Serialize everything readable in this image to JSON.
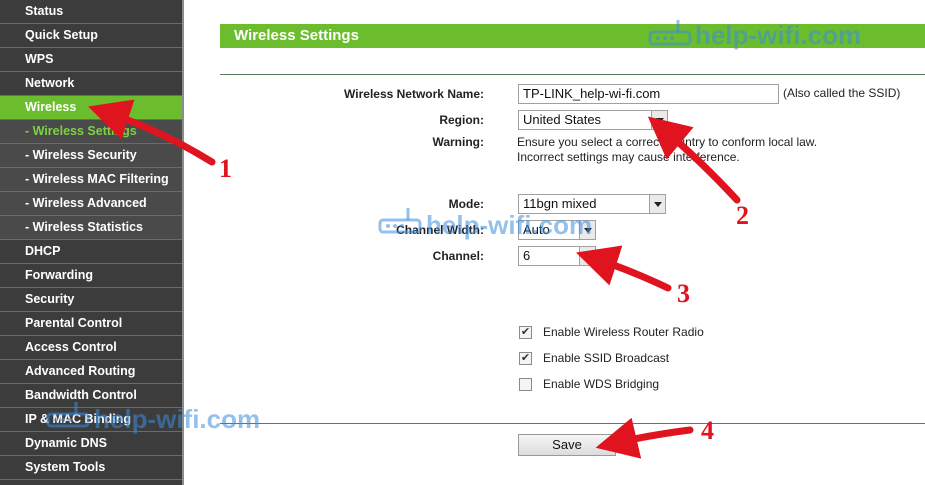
{
  "sidebar": {
    "items": [
      {
        "label": "Status",
        "type": "main"
      },
      {
        "label": "Quick Setup",
        "type": "main"
      },
      {
        "label": "WPS",
        "type": "main"
      },
      {
        "label": "Network",
        "type": "main"
      },
      {
        "label": "Wireless",
        "type": "active"
      },
      {
        "label": "- Wireless Settings",
        "type": "sub-current"
      },
      {
        "label": "- Wireless Security",
        "type": "sub"
      },
      {
        "label": "- Wireless MAC Filtering",
        "type": "sub"
      },
      {
        "label": "- Wireless Advanced",
        "type": "sub"
      },
      {
        "label": "- Wireless Statistics",
        "type": "sub"
      },
      {
        "label": "DHCP",
        "type": "main"
      },
      {
        "label": "Forwarding",
        "type": "main"
      },
      {
        "label": "Security",
        "type": "main"
      },
      {
        "label": "Parental Control",
        "type": "main"
      },
      {
        "label": "Access Control",
        "type": "main"
      },
      {
        "label": "Advanced Routing",
        "type": "main"
      },
      {
        "label": "Bandwidth Control",
        "type": "main"
      },
      {
        "label": "IP & MAC Binding",
        "type": "main"
      },
      {
        "label": "Dynamic DNS",
        "type": "main"
      },
      {
        "label": "System Tools",
        "type": "main"
      }
    ]
  },
  "header": {
    "title": "Wireless Settings"
  },
  "form": {
    "ssid_label": "Wireless Network Name:",
    "ssid_value": "TP-LINK_help-wi-fi.com",
    "ssid_hint": "(Also called the SSID)",
    "region_label": "Region:",
    "region_value": "United States",
    "warning_label": "Warning:",
    "warning_line1": "Ensure you select a correct country to conform local law.",
    "warning_line2": "Incorrect settings may cause interference.",
    "mode_label": "Mode:",
    "mode_value": "11bgn mixed",
    "width_label": "Channel Width:",
    "width_value": "Auto",
    "channel_label": "Channel:",
    "channel_value": "6"
  },
  "options": {
    "radio_label": "Enable Wireless Router Radio",
    "radio_checked": true,
    "ssid_broadcast_label": "Enable SSID Broadcast",
    "ssid_broadcast_checked": true,
    "wds_label": "Enable WDS Bridging",
    "wds_checked": false
  },
  "save_label": "Save",
  "watermark": {
    "text": "help-wifi.com"
  },
  "annotations": {
    "n1": "1",
    "n2": "2",
    "n3": "3",
    "n4": "4"
  },
  "colors": {
    "accent": "#6cbd2e",
    "sidebar_bg": "#3c3c3c",
    "annotation": "#e0141e"
  }
}
